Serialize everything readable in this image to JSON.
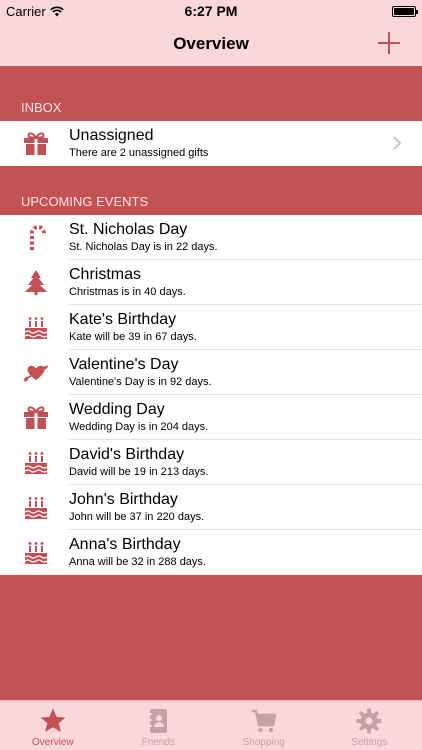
{
  "status": {
    "carrier": "Carrier",
    "time": "6:27 PM"
  },
  "nav": {
    "title": "Overview"
  },
  "inbox": {
    "header": "INBOX",
    "item": {
      "icon": "gift-icon",
      "title": "Unassigned",
      "subtitle": "There are 2 unassigned gifts"
    }
  },
  "upcoming": {
    "header": "UPCOMING EVENTS",
    "items": [
      {
        "icon": "candy-cane-icon",
        "title": "St. Nicholas Day",
        "subtitle": "St. Nicholas Day is in 22 days."
      },
      {
        "icon": "christmas-tree-icon",
        "title": "Christmas",
        "subtitle": "Christmas is in 40 days."
      },
      {
        "icon": "birthday-cake-icon",
        "title": "Kate's Birthday",
        "subtitle": "Kate will be 39 in 67 days."
      },
      {
        "icon": "heart-arrow-icon",
        "title": "Valentine's Day",
        "subtitle": "Valentine's Day is in 92 days."
      },
      {
        "icon": "gift-icon",
        "title": "Wedding Day",
        "subtitle": "Wedding Day is in 204 days."
      },
      {
        "icon": "birthday-cake-icon",
        "title": "David's Birthday",
        "subtitle": "David will be 19 in 213 days."
      },
      {
        "icon": "birthday-cake-icon",
        "title": "John's Birthday",
        "subtitle": "John will be 37 in 220 days."
      },
      {
        "icon": "birthday-cake-icon",
        "title": "Anna's Birthday",
        "subtitle": "Anna will be 32 in 288 days."
      }
    ]
  },
  "tabs": [
    {
      "icon": "star-icon",
      "label": "Overview",
      "active": true
    },
    {
      "icon": "address-book-icon",
      "label": "Friends",
      "active": false
    },
    {
      "icon": "shopping-cart-icon",
      "label": "Shopping",
      "active": false
    },
    {
      "icon": "gear-icon",
      "label": "Settings",
      "active": false
    }
  ],
  "colors": {
    "accent": "#c24f53",
    "bar": "#fad7d8",
    "background": "#c25254",
    "tab_inactive": "#c3a3a4"
  }
}
